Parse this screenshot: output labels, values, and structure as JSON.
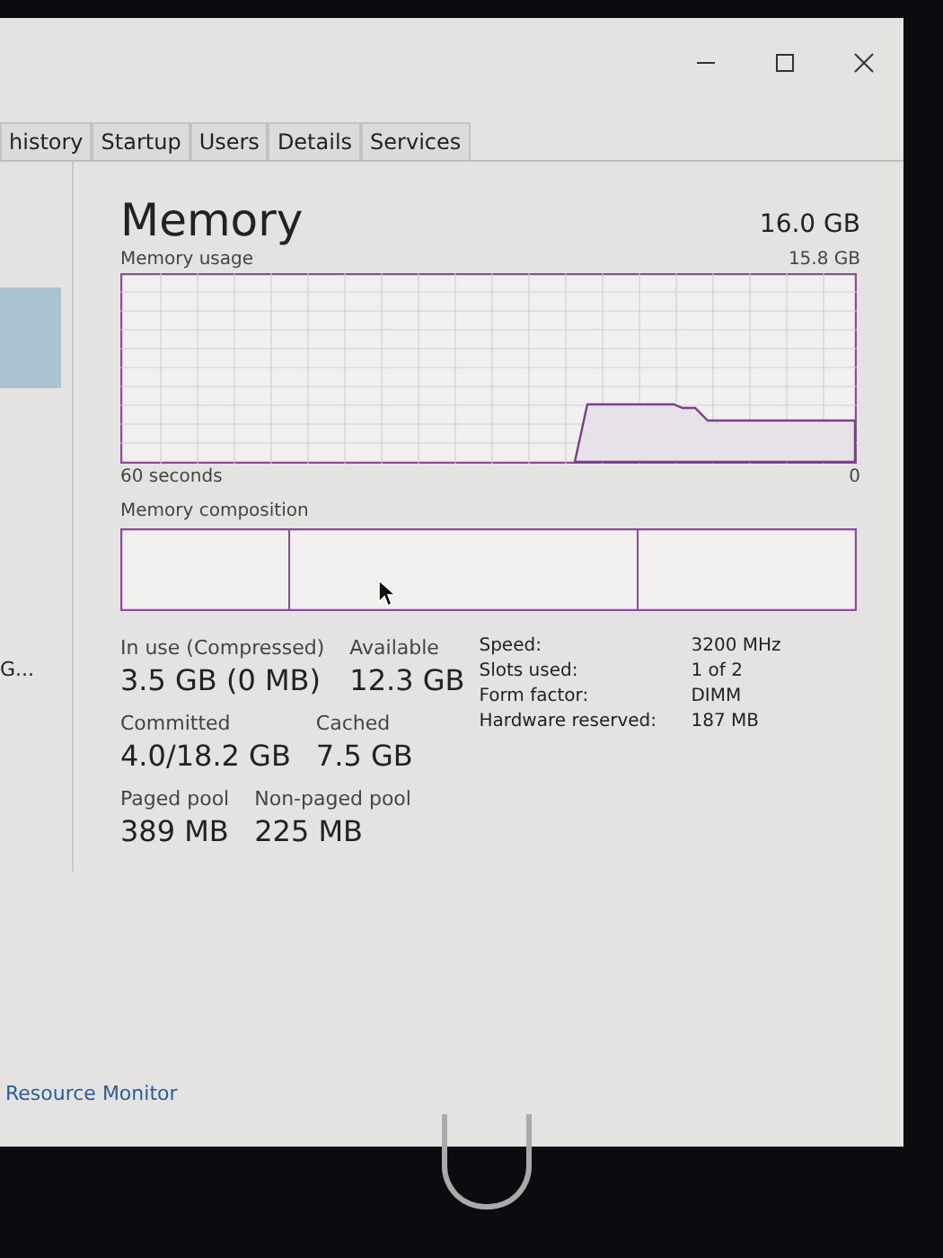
{
  "window": {
    "controls": [
      {
        "kind": "minimize"
      },
      {
        "kind": "maximize"
      },
      {
        "kind": "close"
      }
    ]
  },
  "tabs": [
    {
      "label": "history",
      "selected": false
    },
    {
      "label": "Startup",
      "selected": false
    },
    {
      "label": "Users",
      "selected": false
    },
    {
      "label": "Details",
      "selected": false
    },
    {
      "label": "Services",
      "selected": false
    }
  ],
  "sidebar": {
    "items": [
      {
        "label": "G..."
      }
    ]
  },
  "memory": {
    "title": "Memory",
    "total": "16.0 GB",
    "usage_label": "Memory usage",
    "usage_max": "15.8 GB",
    "time_start": "60 seconds",
    "time_end": "0",
    "composition_label": "Memory composition",
    "stats": [
      [
        {
          "label": "In use (Compressed)",
          "value": "3.5 GB (0 MB)"
        },
        {
          "label": "Available",
          "value": "12.3 GB"
        }
      ],
      [
        {
          "label": "Committed",
          "value": "4.0/18.2 GB"
        },
        {
          "label": "Cached",
          "value": "7.5 GB"
        }
      ],
      [
        {
          "label": "Paged pool",
          "value": "389 MB"
        },
        {
          "label": "Non-paged pool",
          "value": "225 MB"
        }
      ]
    ],
    "specs": [
      {
        "label": "Speed:",
        "value": "3200 MHz"
      },
      {
        "label": "Slots used:",
        "value": "1 of 2"
      },
      {
        "label": "Form factor:",
        "value": "DIMM"
      },
      {
        "label": "Hardware reserved:",
        "value": "187 MB"
      }
    ]
  },
  "footer": {
    "link": "Resource Monitor"
  }
}
